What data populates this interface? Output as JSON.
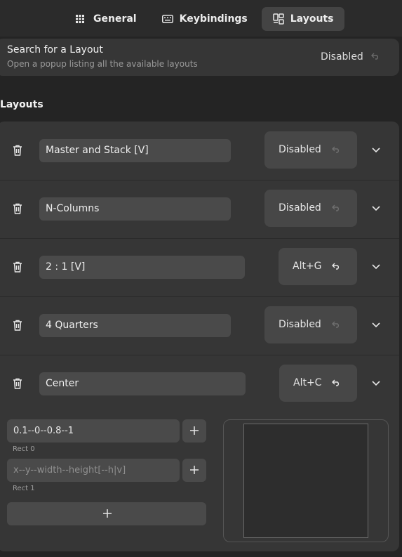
{
  "tabs": [
    {
      "label": "General",
      "icon": "grid-icon",
      "active": false
    },
    {
      "label": "Keybindings",
      "icon": "keyboard-icon",
      "active": false
    },
    {
      "label": "Layouts",
      "icon": "layout-icon",
      "active": true
    }
  ],
  "search_layout": {
    "title": "Search for a Layout",
    "subtitle": "Open a popup listing all the available layouts",
    "value": "Disabled"
  },
  "section_title": "Layouts",
  "layouts": [
    {
      "name": "Master and Stack [V]",
      "shortcut": "Disabled"
    },
    {
      "name": "N-Columns",
      "shortcut": "Disabled"
    },
    {
      "name": "2 : 1 [V]",
      "shortcut": "Alt+G"
    },
    {
      "name": "4 Quarters",
      "shortcut": "Disabled"
    },
    {
      "name": "Center",
      "shortcut": "Alt+C"
    }
  ],
  "rects": [
    {
      "value": "0.1--0--0.8--1",
      "caption": "Rect 0"
    },
    {
      "placeholder": "x--y--width--height[--h|v]",
      "caption": "Rect 1"
    }
  ],
  "colors": {
    "background": "#242424",
    "row": "#363636",
    "entry": "#4a4a4a",
    "active_tab": "#444444"
  }
}
